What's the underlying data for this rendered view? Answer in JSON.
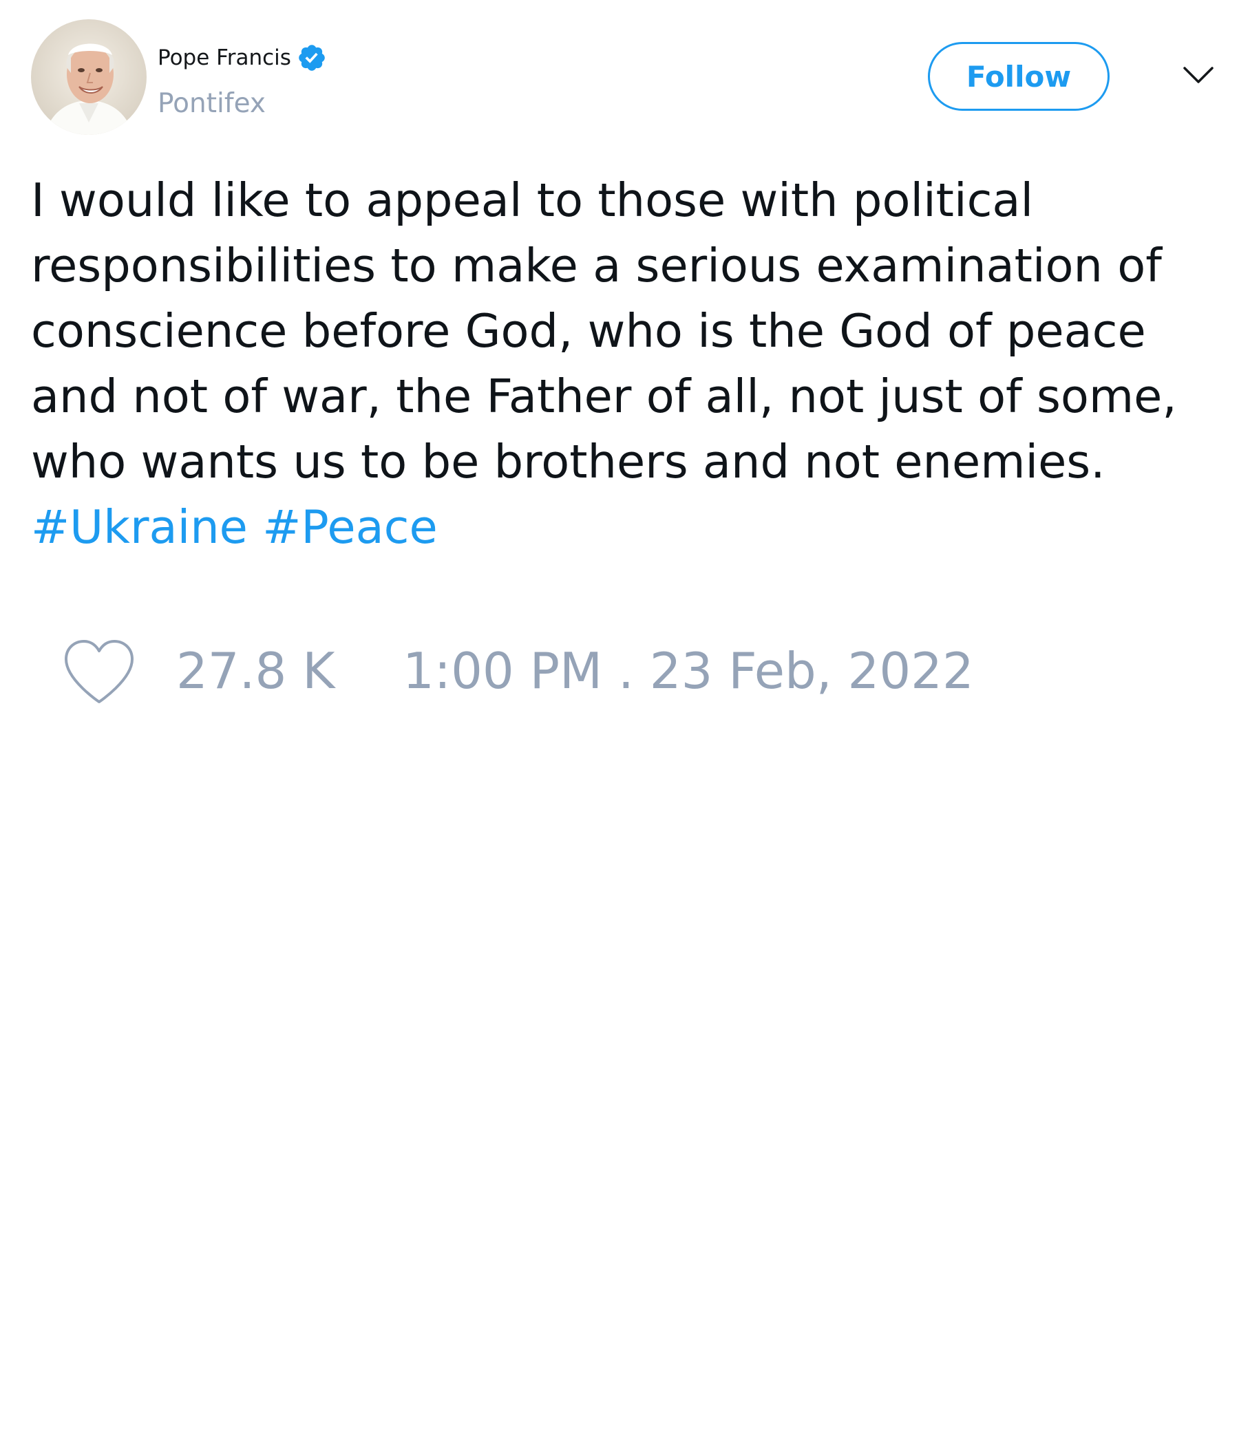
{
  "author": {
    "display_name": "Pope Francis",
    "handle": "Pontifex",
    "verified": true,
    "avatar_icon": "avatar-photo"
  },
  "header": {
    "follow_label": "Follow",
    "menu_icon": "chevron-down-icon"
  },
  "tweet": {
    "lines": [
      "I would like to appeal to those with political",
      "responsibilities to make a serious examination of",
      "conscience before God, who is the God of peace",
      "and not of war, the Father of all, not just of some,",
      "who wants us to be brothers and not enemies."
    ],
    "hashtags": [
      "#Ukraine",
      "#Peace"
    ]
  },
  "footer": {
    "like_icon": "heart-icon",
    "like_count": "27.8 K",
    "timestamp": "1:00 PM . 23 Feb, 2022"
  },
  "colors": {
    "accent": "#1d9bf0",
    "text": "#0f1419",
    "muted": "#95a3b7",
    "background": "#ffffff"
  }
}
